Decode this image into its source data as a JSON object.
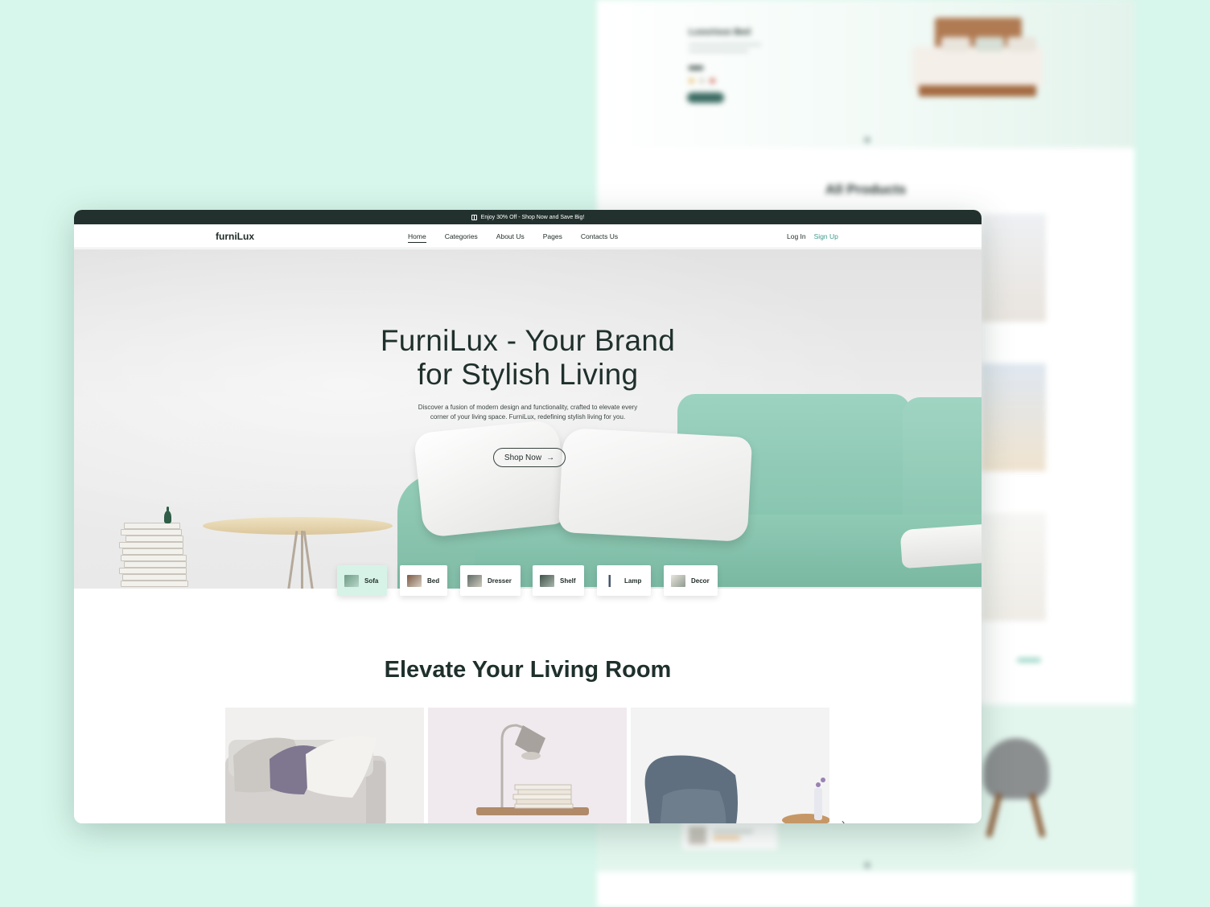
{
  "promo": {
    "text": "Enjoy 30% Off  - Shop Now and Save Big!"
  },
  "brand": {
    "logo": "furniLux"
  },
  "nav": {
    "links": [
      "Home",
      "Categories",
      "About  Us",
      "Pages",
      "Contacts Us"
    ],
    "active": "Home",
    "login": "Log In",
    "signup": "Sign Up"
  },
  "hero": {
    "title_line1": "FurniLux - Your Brand",
    "title_line2": "for Stylish Living",
    "subtitle_line1": "Discover a fusion of modern design and functionality, crafted to elevate every",
    "subtitle_line2": "corner of your living space. FurniLux, redefining stylish living for you.",
    "cta": "Shop Now",
    "cta_icon": "arrow-right-icon"
  },
  "categories": [
    {
      "label": "Sofa",
      "active": true
    },
    {
      "label": "Bed",
      "active": false
    },
    {
      "label": "Dresser",
      "active": false
    },
    {
      "label": "Shelf",
      "active": false
    },
    {
      "label": "Lamp",
      "active": false
    },
    {
      "label": "Decor",
      "active": false
    }
  ],
  "section": {
    "title": "Elevate Your Living Room"
  },
  "background_page": {
    "hero_title": "Luxurious Bed",
    "products_title": "All Products"
  },
  "colors": {
    "page_bg": "#d8f7ec",
    "promo_bar": "#22312d",
    "accent": "#3d9a8d",
    "chip_active": "#d7f3e8",
    "sofa": "#8fcab5"
  }
}
